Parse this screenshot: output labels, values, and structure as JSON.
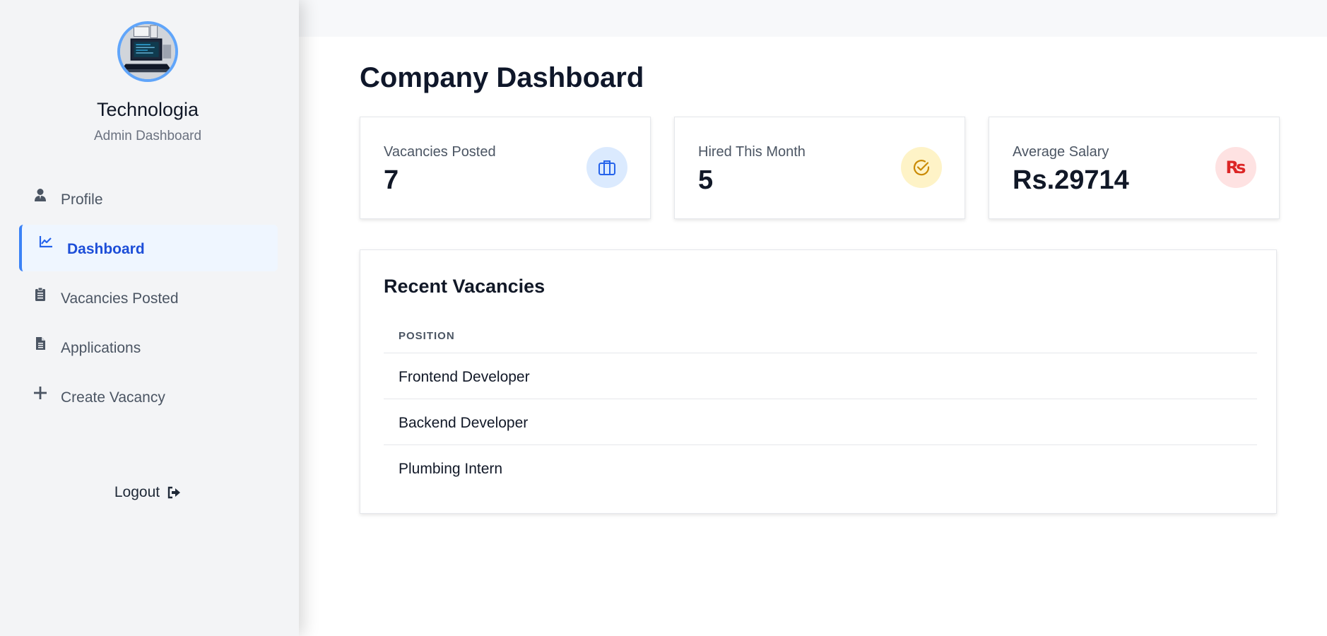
{
  "sidebar": {
    "company_name": "Technologia",
    "subtitle": "Admin Dashboard",
    "items": [
      {
        "label": "Profile",
        "icon": "user-icon",
        "active": false
      },
      {
        "label": "Dashboard",
        "icon": "chart-line-icon",
        "active": true
      },
      {
        "label": "Vacancies Posted",
        "icon": "clipboard-list-icon",
        "active": false
      },
      {
        "label": "Applications",
        "icon": "file-text-icon",
        "active": false
      },
      {
        "label": "Create Vacancy",
        "icon": "plus-icon",
        "active": false
      }
    ],
    "logout_label": "Logout",
    "logout_icon": "sign-out-icon"
  },
  "main": {
    "title": "Company Dashboard",
    "stats": [
      {
        "label": "Vacancies Posted",
        "value": "7",
        "icon": "briefcase-icon",
        "icon_bg": "#dbeafe",
        "icon_color": "#2563eb"
      },
      {
        "label": "Hired This Month",
        "value": "5",
        "icon": "check-circle-icon",
        "icon_bg": "#fef3c7",
        "icon_color": "#ca8a04"
      },
      {
        "label": "Average Salary",
        "value": "Rs.29714",
        "icon": "rupee-icon",
        "icon_glyph": "₨",
        "icon_bg": "#fee2e2",
        "icon_color": "#dc2626"
      }
    ],
    "recent": {
      "title": "Recent Vacancies",
      "column_header": "POSITION",
      "rows": [
        "Frontend Developer",
        "Backend Developer",
        "Plumbing Intern"
      ]
    }
  },
  "colors": {
    "accent": "#3b82f6",
    "active_text": "#1d4ed8",
    "sidebar_bg": "#f3f4f6"
  }
}
